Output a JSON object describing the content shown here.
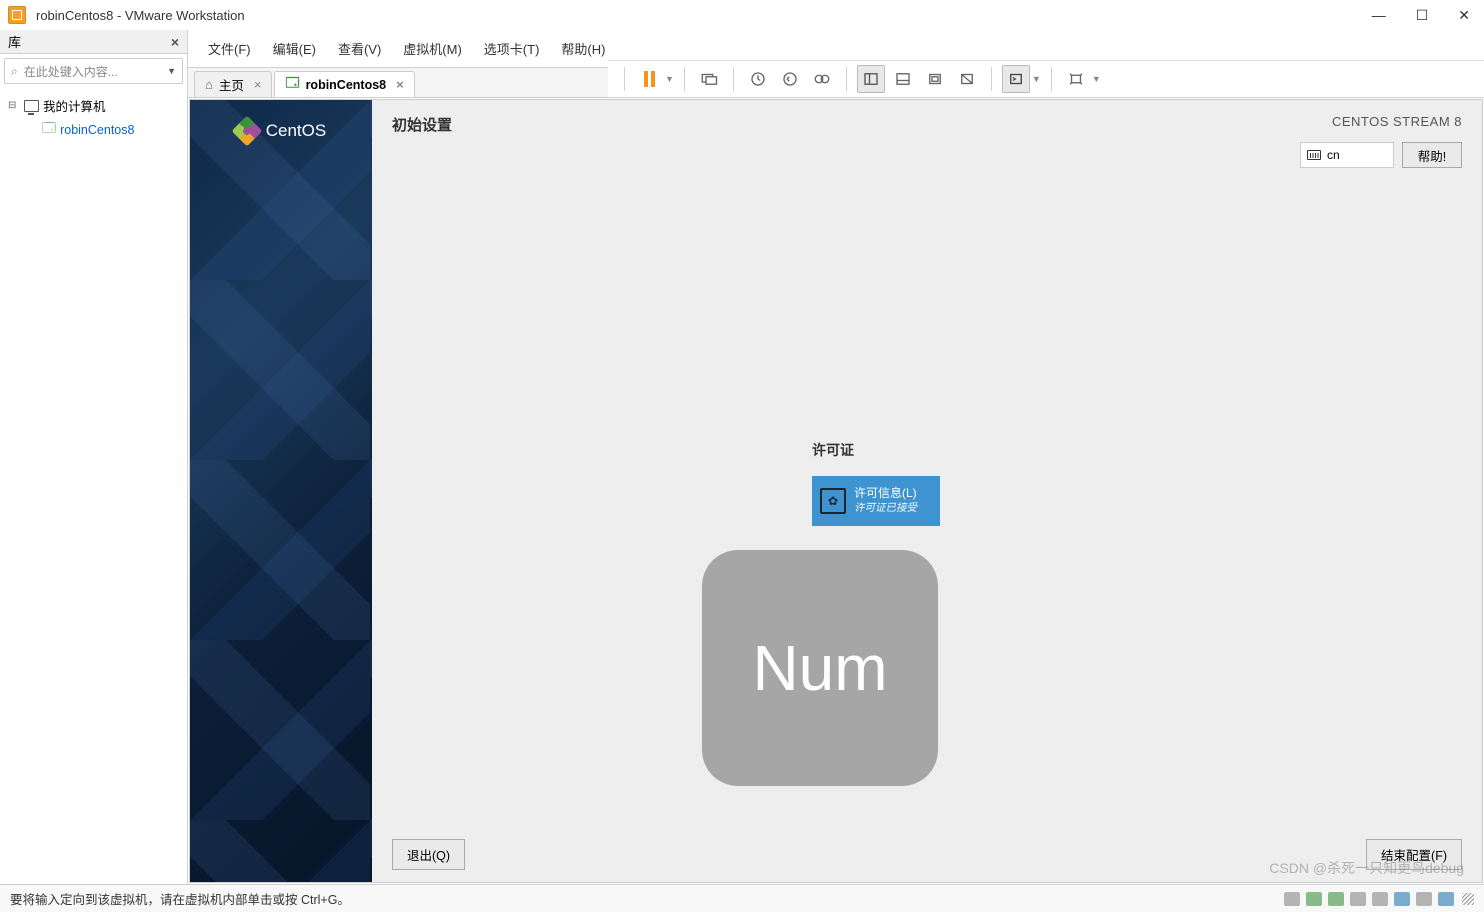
{
  "window": {
    "title": "robinCentos8 - VMware Workstation"
  },
  "menu": {
    "file": "文件(F)",
    "edit": "编辑(E)",
    "view": "查看(V)",
    "vm": "虚拟机(M)",
    "tabs": "选项卡(T)",
    "help": "帮助(H)"
  },
  "library": {
    "title": "库",
    "search_placeholder": "在此处键入内容...",
    "root": "我的计算机",
    "items": [
      "robinCentos8"
    ]
  },
  "tabs": {
    "home": "主页",
    "vm": "robinCentos8"
  },
  "installer": {
    "brand": "CentOS",
    "title": "初始设置",
    "distro": "CENTOS STREAM 8",
    "keyboard_layout": "cn",
    "help": "帮助!",
    "license_heading": "许可证",
    "license_title": "许可信息(L)",
    "license_sub": "许可证已接受",
    "exit": "退出(Q)",
    "finish": "结束配置(F)",
    "overlay": "Num"
  },
  "statusbar": {
    "hint": "要将输入定向到该虚拟机，请在虚拟机内部单击或按 Ctrl+G。",
    "watermark": "CSDN @杀死一只知更鸟debug"
  }
}
